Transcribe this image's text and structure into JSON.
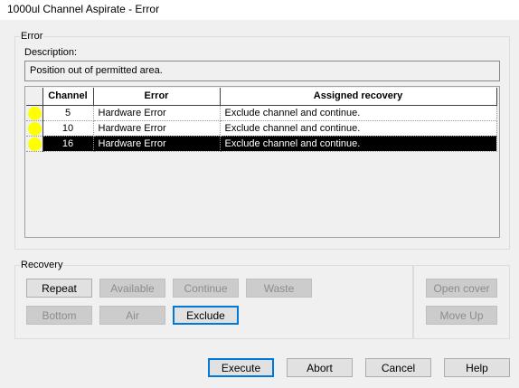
{
  "window": {
    "title": "1000ul Channel Aspirate - Error"
  },
  "error_group": {
    "label": "Error",
    "description_label": "Description:",
    "description": "Position out of permitted area."
  },
  "grid": {
    "columns": [
      "Channel",
      "Error",
      "Assigned recovery"
    ],
    "rows": [
      {
        "indicator": "yellow-dot",
        "channel": "5",
        "error": "Hardware Error",
        "recovery": "Exclude channel and continue.",
        "selected": false
      },
      {
        "indicator": "yellow-dot",
        "channel": "10",
        "error": "Hardware Error",
        "recovery": "Exclude channel and continue.",
        "selected": false
      },
      {
        "indicator": "yellow-dot",
        "channel": "16",
        "error": "Hardware Error",
        "recovery": "Exclude channel and continue.",
        "selected": true
      }
    ]
  },
  "recovery_group": {
    "label": "Recovery",
    "buttons": {
      "repeat": "Repeat",
      "available": "Available",
      "continue": "Continue",
      "waste": "Waste",
      "bottom": "Bottom",
      "air": "Air",
      "exclude": "Exclude",
      "open_cover": "Open cover",
      "move_up": "Move Up"
    }
  },
  "footer": {
    "execute": "Execute",
    "abort": "Abort",
    "cancel": "Cancel",
    "help": "Help"
  },
  "colors": {
    "indicator": "#ffff00",
    "selection": "#000000",
    "focus": "#0078d7"
  }
}
